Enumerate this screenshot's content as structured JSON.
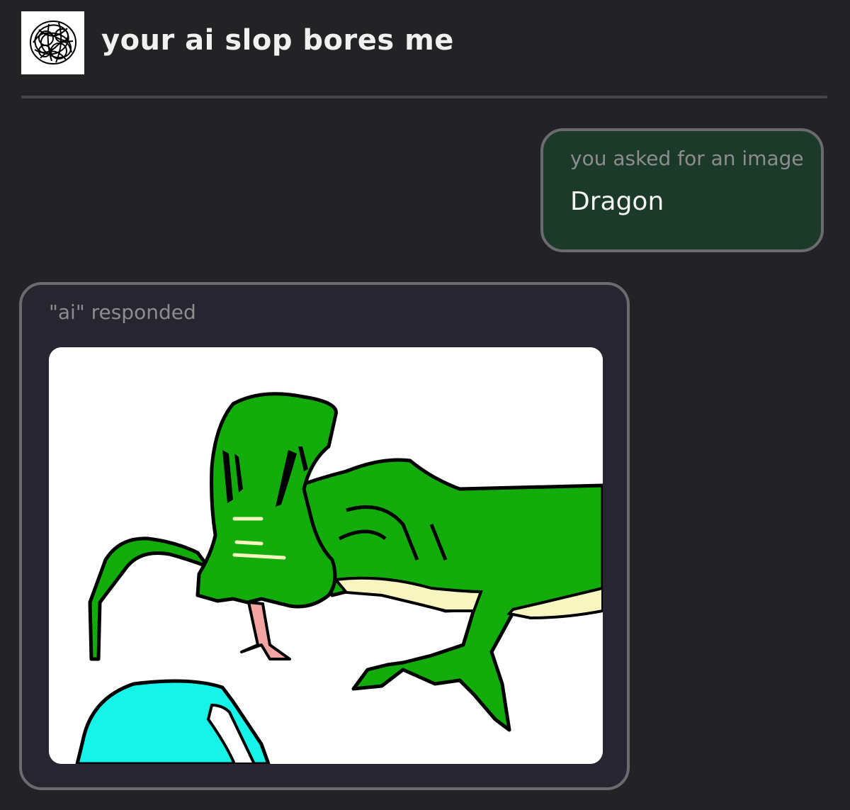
{
  "header": {
    "title": "your ai slop bores me",
    "avatar_icon": "scribble-avatar-icon"
  },
  "messages": {
    "user": {
      "caption": "you asked for an image",
      "text": "Dragon"
    },
    "ai": {
      "caption": "\"ai\" responded",
      "image_subject": "dragon-drawing"
    }
  },
  "colors": {
    "background": "#232325",
    "user_bubble": "#1c3a29",
    "ai_card": "#27252f",
    "border": "#6a6a6f",
    "dragon_green": "#12ad0a",
    "dragon_belly": "#f8f6c0",
    "tongue": "#f2a5a2",
    "water": "#16f4ea"
  }
}
